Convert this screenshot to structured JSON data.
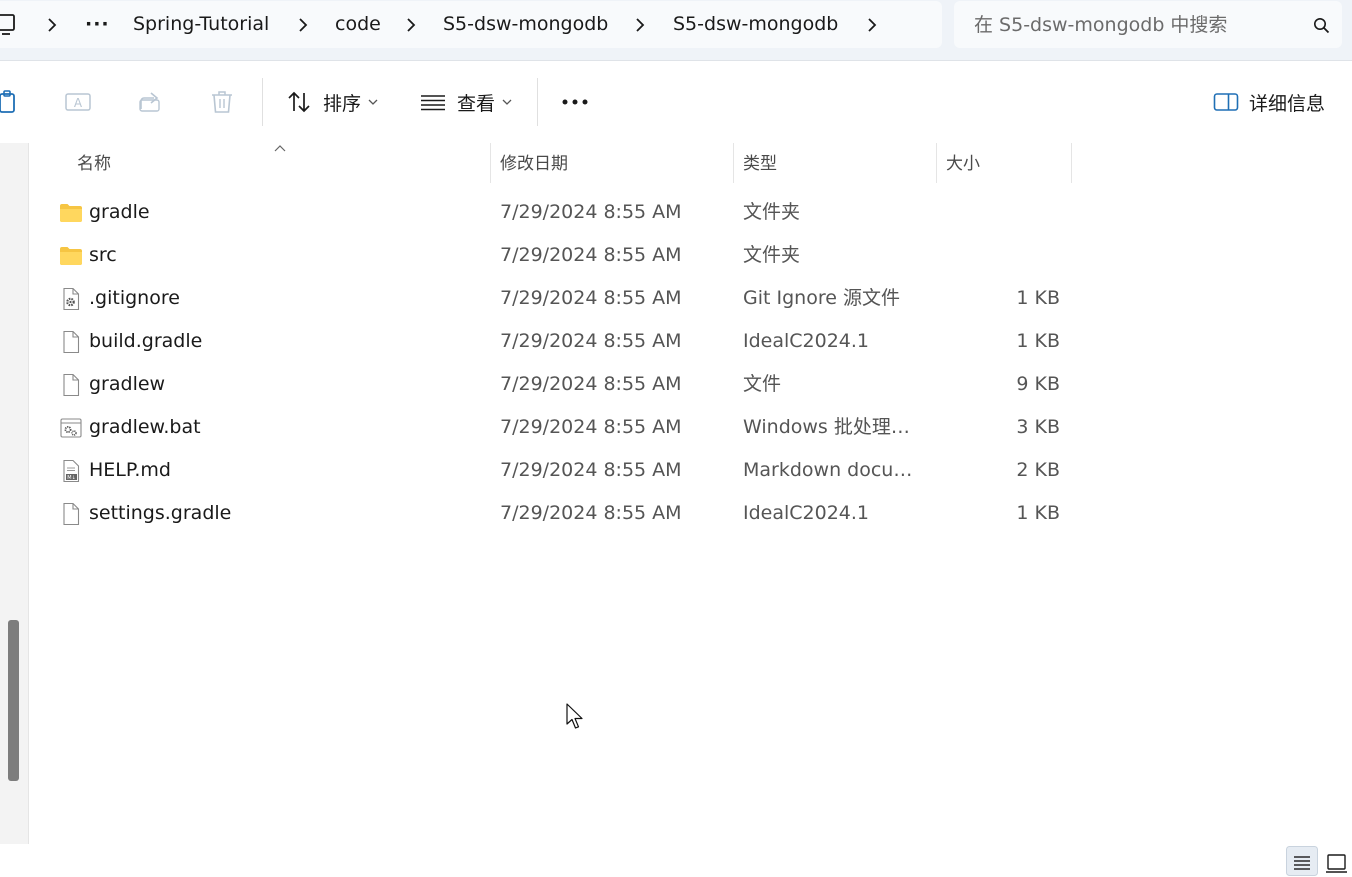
{
  "breadcrumb": {
    "overflow": "···",
    "items": [
      "Spring-Tutorial",
      "code",
      "S5-dsw-mongodb",
      "S5-dsw-mongodb"
    ]
  },
  "search": {
    "placeholder": "在 S5-dsw-mongodb 中搜索"
  },
  "toolbar": {
    "sort_label": "排序",
    "view_label": "查看",
    "more_label": "···",
    "details_label": "详细信息",
    "icons": [
      "copy-icon",
      "rename-icon",
      "share-icon",
      "delete-icon",
      "sort-icon",
      "view-icon",
      "more-icon",
      "details-pane-icon"
    ]
  },
  "columns": {
    "name": "名称",
    "date": "修改日期",
    "type": "类型",
    "size": "大小"
  },
  "files": [
    {
      "name": "gradle",
      "date": "7/29/2024 8:55 AM",
      "type": "文件夹",
      "size": "",
      "icon": "folder-icon"
    },
    {
      "name": "src",
      "date": "7/29/2024 8:55 AM",
      "type": "文件夹",
      "size": "",
      "icon": "folder-icon"
    },
    {
      "name": ".gitignore",
      "date": "7/29/2024 8:55 AM",
      "type": "Git Ignore 源文件",
      "size": "1 KB",
      "icon": "gear-file-icon"
    },
    {
      "name": "build.gradle",
      "date": "7/29/2024 8:55 AM",
      "type": "IdealC2024.1",
      "size": "1 KB",
      "icon": "file-icon"
    },
    {
      "name": "gradlew",
      "date": "7/29/2024 8:55 AM",
      "type": "文件",
      "size": "9 KB",
      "icon": "file-icon"
    },
    {
      "name": "gradlew.bat",
      "date": "7/29/2024 8:55 AM",
      "type": "Windows 批处理文件",
      "size": "3 KB",
      "icon": "batch-file-icon"
    },
    {
      "name": "HELP.md",
      "date": "7/29/2024 8:55 AM",
      "type": "Markdown docume...",
      "size": "2 KB",
      "icon": "markdown-file-icon"
    },
    {
      "name": "settings.gradle",
      "date": "7/29/2024 8:55 AM",
      "type": "IdealC2024.1",
      "size": "1 KB",
      "icon": "file-icon"
    }
  ],
  "colors": {
    "accent": "#1f6fb5",
    "folder": "#f6c543",
    "scrollbar": "#7d7d7d"
  }
}
